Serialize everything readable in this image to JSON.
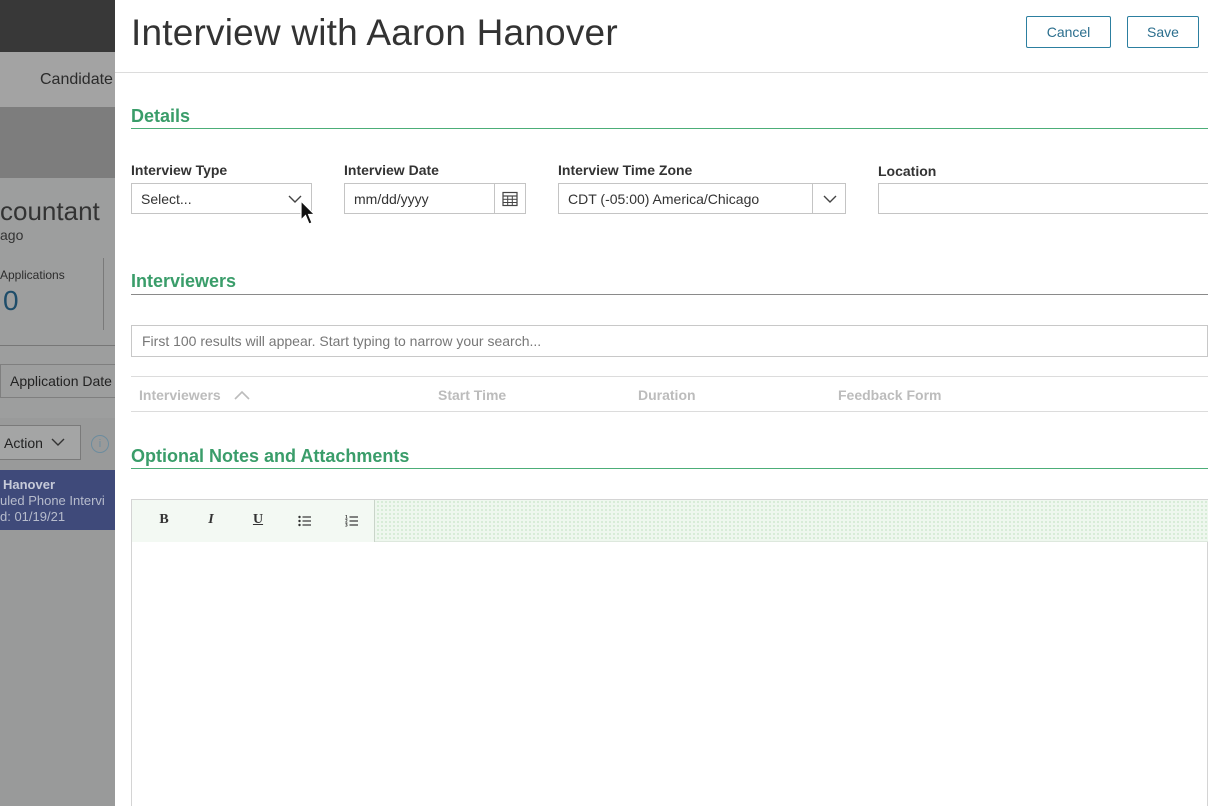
{
  "background": {
    "nav_label": "Candidate",
    "job_title": "countant",
    "job_location": "ago",
    "applications_label": "Applications",
    "applications_count": "0",
    "application_date_label": "Application Date",
    "action_label": "Action",
    "selected_row": {
      "name": "Hanover",
      "status": "uled Phone Intervi",
      "date": "d: 01/19/21"
    }
  },
  "modal": {
    "title": "Interview with Aaron Hanover",
    "cancel_label": "Cancel",
    "save_label": "Save"
  },
  "details": {
    "heading": "Details",
    "interview_type": {
      "label": "Interview Type",
      "value": "Select..."
    },
    "interview_date": {
      "label": "Interview Date",
      "placeholder": "mm/dd/yyyy"
    },
    "time_zone": {
      "label": "Interview Time Zone",
      "value": "CDT (-05:00) America/Chicago"
    },
    "location": {
      "label": "Location",
      "value": ""
    }
  },
  "interviewers": {
    "heading": "Interviewers",
    "search_placeholder": "First 100 results will appear. Start typing to narrow your search...",
    "columns": [
      "Interviewers",
      "Start Time",
      "Duration",
      "Feedback Form"
    ]
  },
  "notes": {
    "heading": "Optional Notes and Attachments",
    "toolbar": {
      "bold": "B",
      "italic": "I",
      "underline": "U"
    },
    "content": ""
  },
  "colors": {
    "accent_green": "#3a9d6a",
    "button_border": "#2c7fa0",
    "selected_row": "#3f4a7a"
  }
}
